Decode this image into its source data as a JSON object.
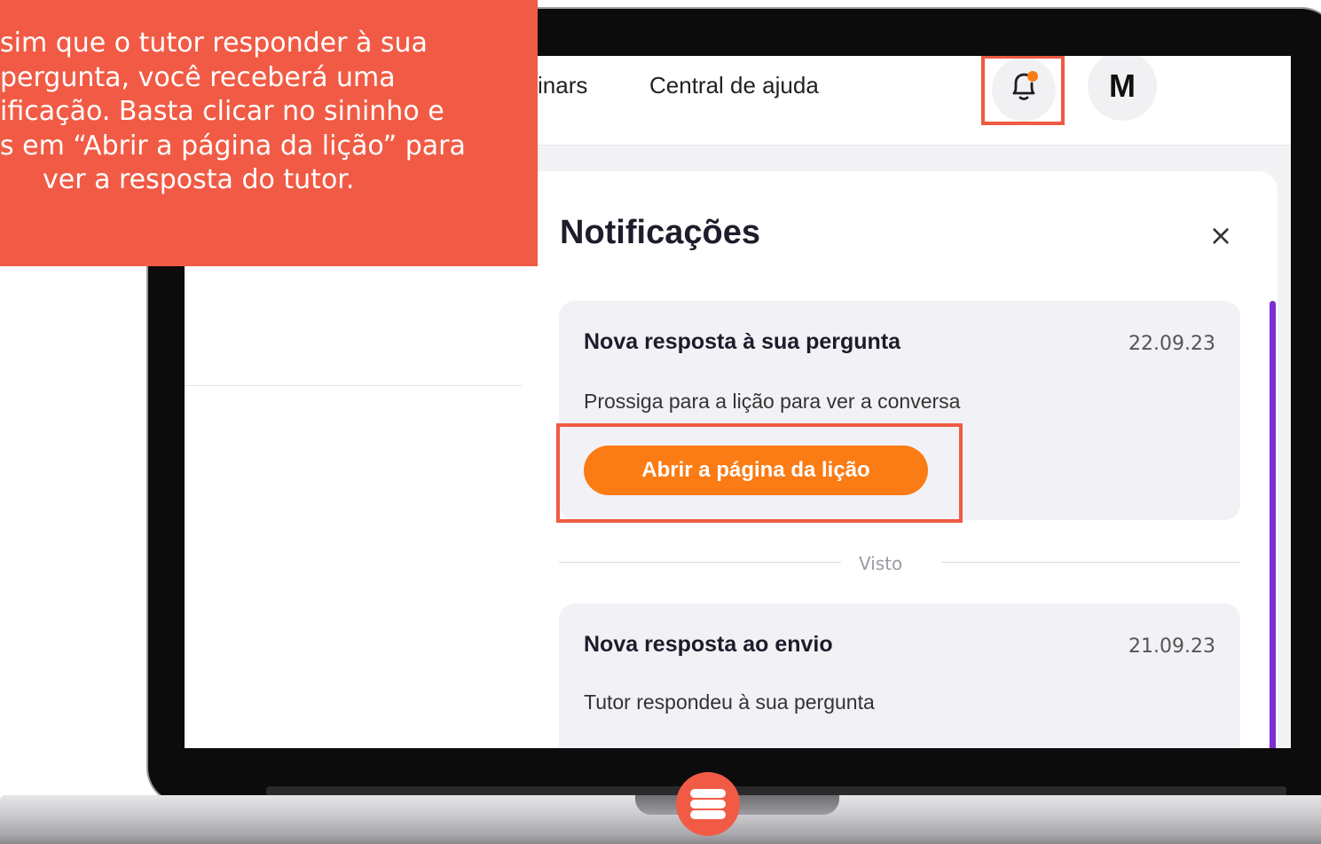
{
  "callout": {
    "lines": [
      "sim que o tutor responder à sua",
      "pergunta, você receberá uma",
      "ificação. Basta clicar no sininho e",
      "s em “Abrir a página da lição” para",
      "ver a resposta do tutor."
    ]
  },
  "nav": {
    "link1": "inars",
    "link2": "Central de ajuda",
    "avatar_letter": "M",
    "bell_icon": "bell-icon",
    "notification_dot_color": "#fb7b14"
  },
  "panel": {
    "title": "Notificações",
    "close_label": "×",
    "divider_label": "Visto",
    "items": [
      {
        "title": "Nova resposta à sua pergunta",
        "date": "22.09.23",
        "body": "Prossiga para a lição para ver a conversa",
        "button": "Abrir a página da lição"
      },
      {
        "title": "Nova resposta ao envio",
        "date": "21.09.23",
        "body": "Tutor respondeu à sua pergunta"
      }
    ]
  },
  "colors": {
    "accent_red": "#f15b45",
    "button_orange": "#fb7b14",
    "scroll_purple": "#7b2fd0"
  }
}
